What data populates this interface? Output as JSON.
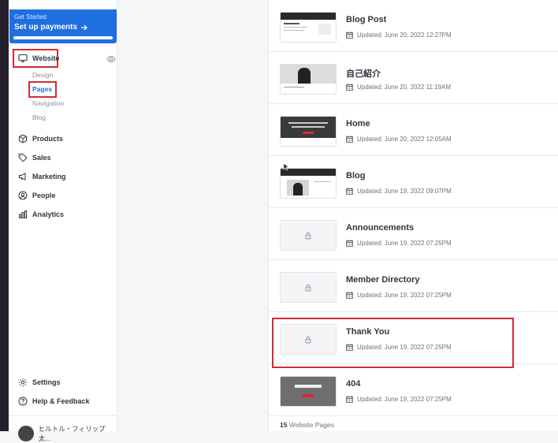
{
  "promo": {
    "eyebrow": "Get Started",
    "cta": "Set up payments",
    "progress": 1.0
  },
  "sidebar": {
    "website": "Website",
    "sub": [
      "Design",
      "Pages",
      "Navigation",
      "Blog"
    ],
    "items": [
      "Products",
      "Sales",
      "Marketing",
      "People",
      "Analytics"
    ],
    "settings": "Settings",
    "help": "Help & Feedback",
    "user": "ヒルトル・フィリップ太..."
  },
  "pages": [
    {
      "title": "Blog Post",
      "updated": "Updated: June 20, 2022 12:27PM",
      "thumb": "blog-post"
    },
    {
      "title": "自己紹介",
      "updated": "Updated: June 20, 2022 11:19AM",
      "thumb": "about"
    },
    {
      "title": "Home",
      "updated": "Updated: June 20, 2022 12:05AM",
      "thumb": "home"
    },
    {
      "title": "Blog",
      "updated": "Updated: June 19, 2022 09:07PM",
      "thumb": "blog"
    },
    {
      "title": "Announcements",
      "updated": "Updated: June 19, 2022 07:25PM",
      "thumb": "lock"
    },
    {
      "title": "Member Directory",
      "updated": "Updated: June 19, 2022 07:25PM",
      "thumb": "lock"
    },
    {
      "title": "Thank You",
      "updated": "Updated: June 19, 2022 07:25PM",
      "thumb": "lock"
    },
    {
      "title": "404",
      "updated": "Updated: June 19, 2022 07:25PM",
      "thumb": "404"
    }
  ],
  "footer": {
    "count": "15",
    "label": "Website Pages"
  },
  "colors": {
    "accent": "#1f6fe0",
    "highlight": "#d52b31"
  }
}
